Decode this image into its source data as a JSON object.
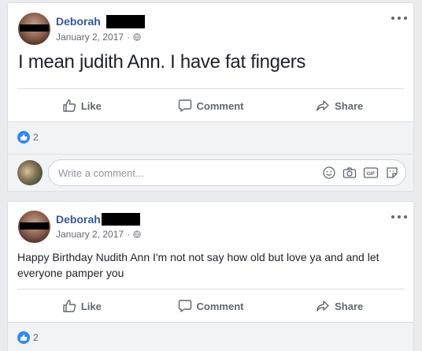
{
  "posts": [
    {
      "author": "Deborah",
      "date": "January 2, 2017",
      "separator": "·",
      "text": "I mean judith Ann. I have fat fingers",
      "actions": {
        "like": "Like",
        "comment": "Comment",
        "share": "Share"
      },
      "reaction_count": "2",
      "comment_placeholder": "Write a comment..."
    },
    {
      "author": "Deborah",
      "date": "January 2, 2017",
      "separator": "·",
      "text": "Happy Birthday Nudith Ann I'm not not say how old but love ya and and let everyone pamper you",
      "actions": {
        "like": "Like",
        "comment": "Comment",
        "share": "Share"
      },
      "reaction_count": "2"
    }
  ],
  "colors": {
    "name": "#365899",
    "like_badge": "#2d88ff",
    "action": "#606770",
    "background": "#e9ebee"
  },
  "icons": [
    "more-options-icon",
    "globe-icon",
    "like-thumb-icon",
    "comment-icon",
    "share-icon",
    "emoji-icon",
    "camera-icon",
    "gif-icon",
    "sticker-icon"
  ]
}
